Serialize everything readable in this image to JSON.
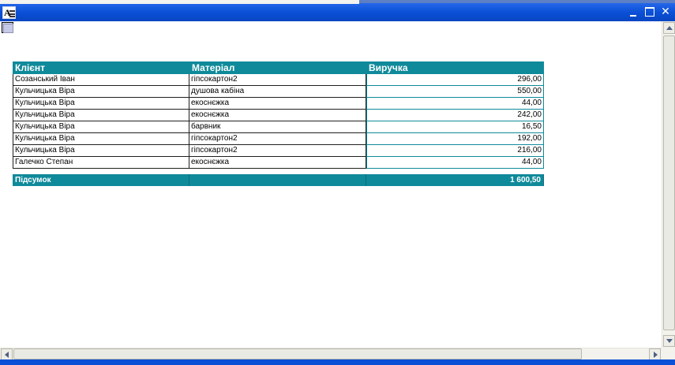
{
  "window": {
    "icon": "report-app-icon",
    "icon_letter": "A",
    "controls": {
      "minimize": "minimize-icon",
      "maximize": "maximize-icon",
      "close": "close-icon",
      "close_glyph": "✕"
    }
  },
  "report": {
    "columns": [
      "Клієнт",
      "Матеріал",
      "Виручка"
    ],
    "rows": [
      [
        "Созанський Іван",
        "гіпсокартон2",
        "296,00"
      ],
      [
        "Кульчицька Віра",
        "душова кабіна",
        "550,00"
      ],
      [
        "Кульчицька Віра",
        "екоснєжка",
        "44,00"
      ],
      [
        "Кульчицька Віра",
        "екоснєжка",
        "242,00"
      ],
      [
        "Кульчицька Віра",
        "барвник",
        "16,50"
      ],
      [
        "Кульчицька Віра",
        "гіпсокартон2",
        "192,00"
      ],
      [
        "Кульчицька Віра",
        "гіпсокартон2",
        "216,00"
      ],
      [
        "Галечко Степан",
        "екоснєжка",
        "44,00"
      ]
    ],
    "total": {
      "label": "Підсумок",
      "middle": "",
      "value": "1 600,50"
    }
  },
  "colors": {
    "accent": "#0f8a9a",
    "titlebar": "#0a4fd6"
  }
}
